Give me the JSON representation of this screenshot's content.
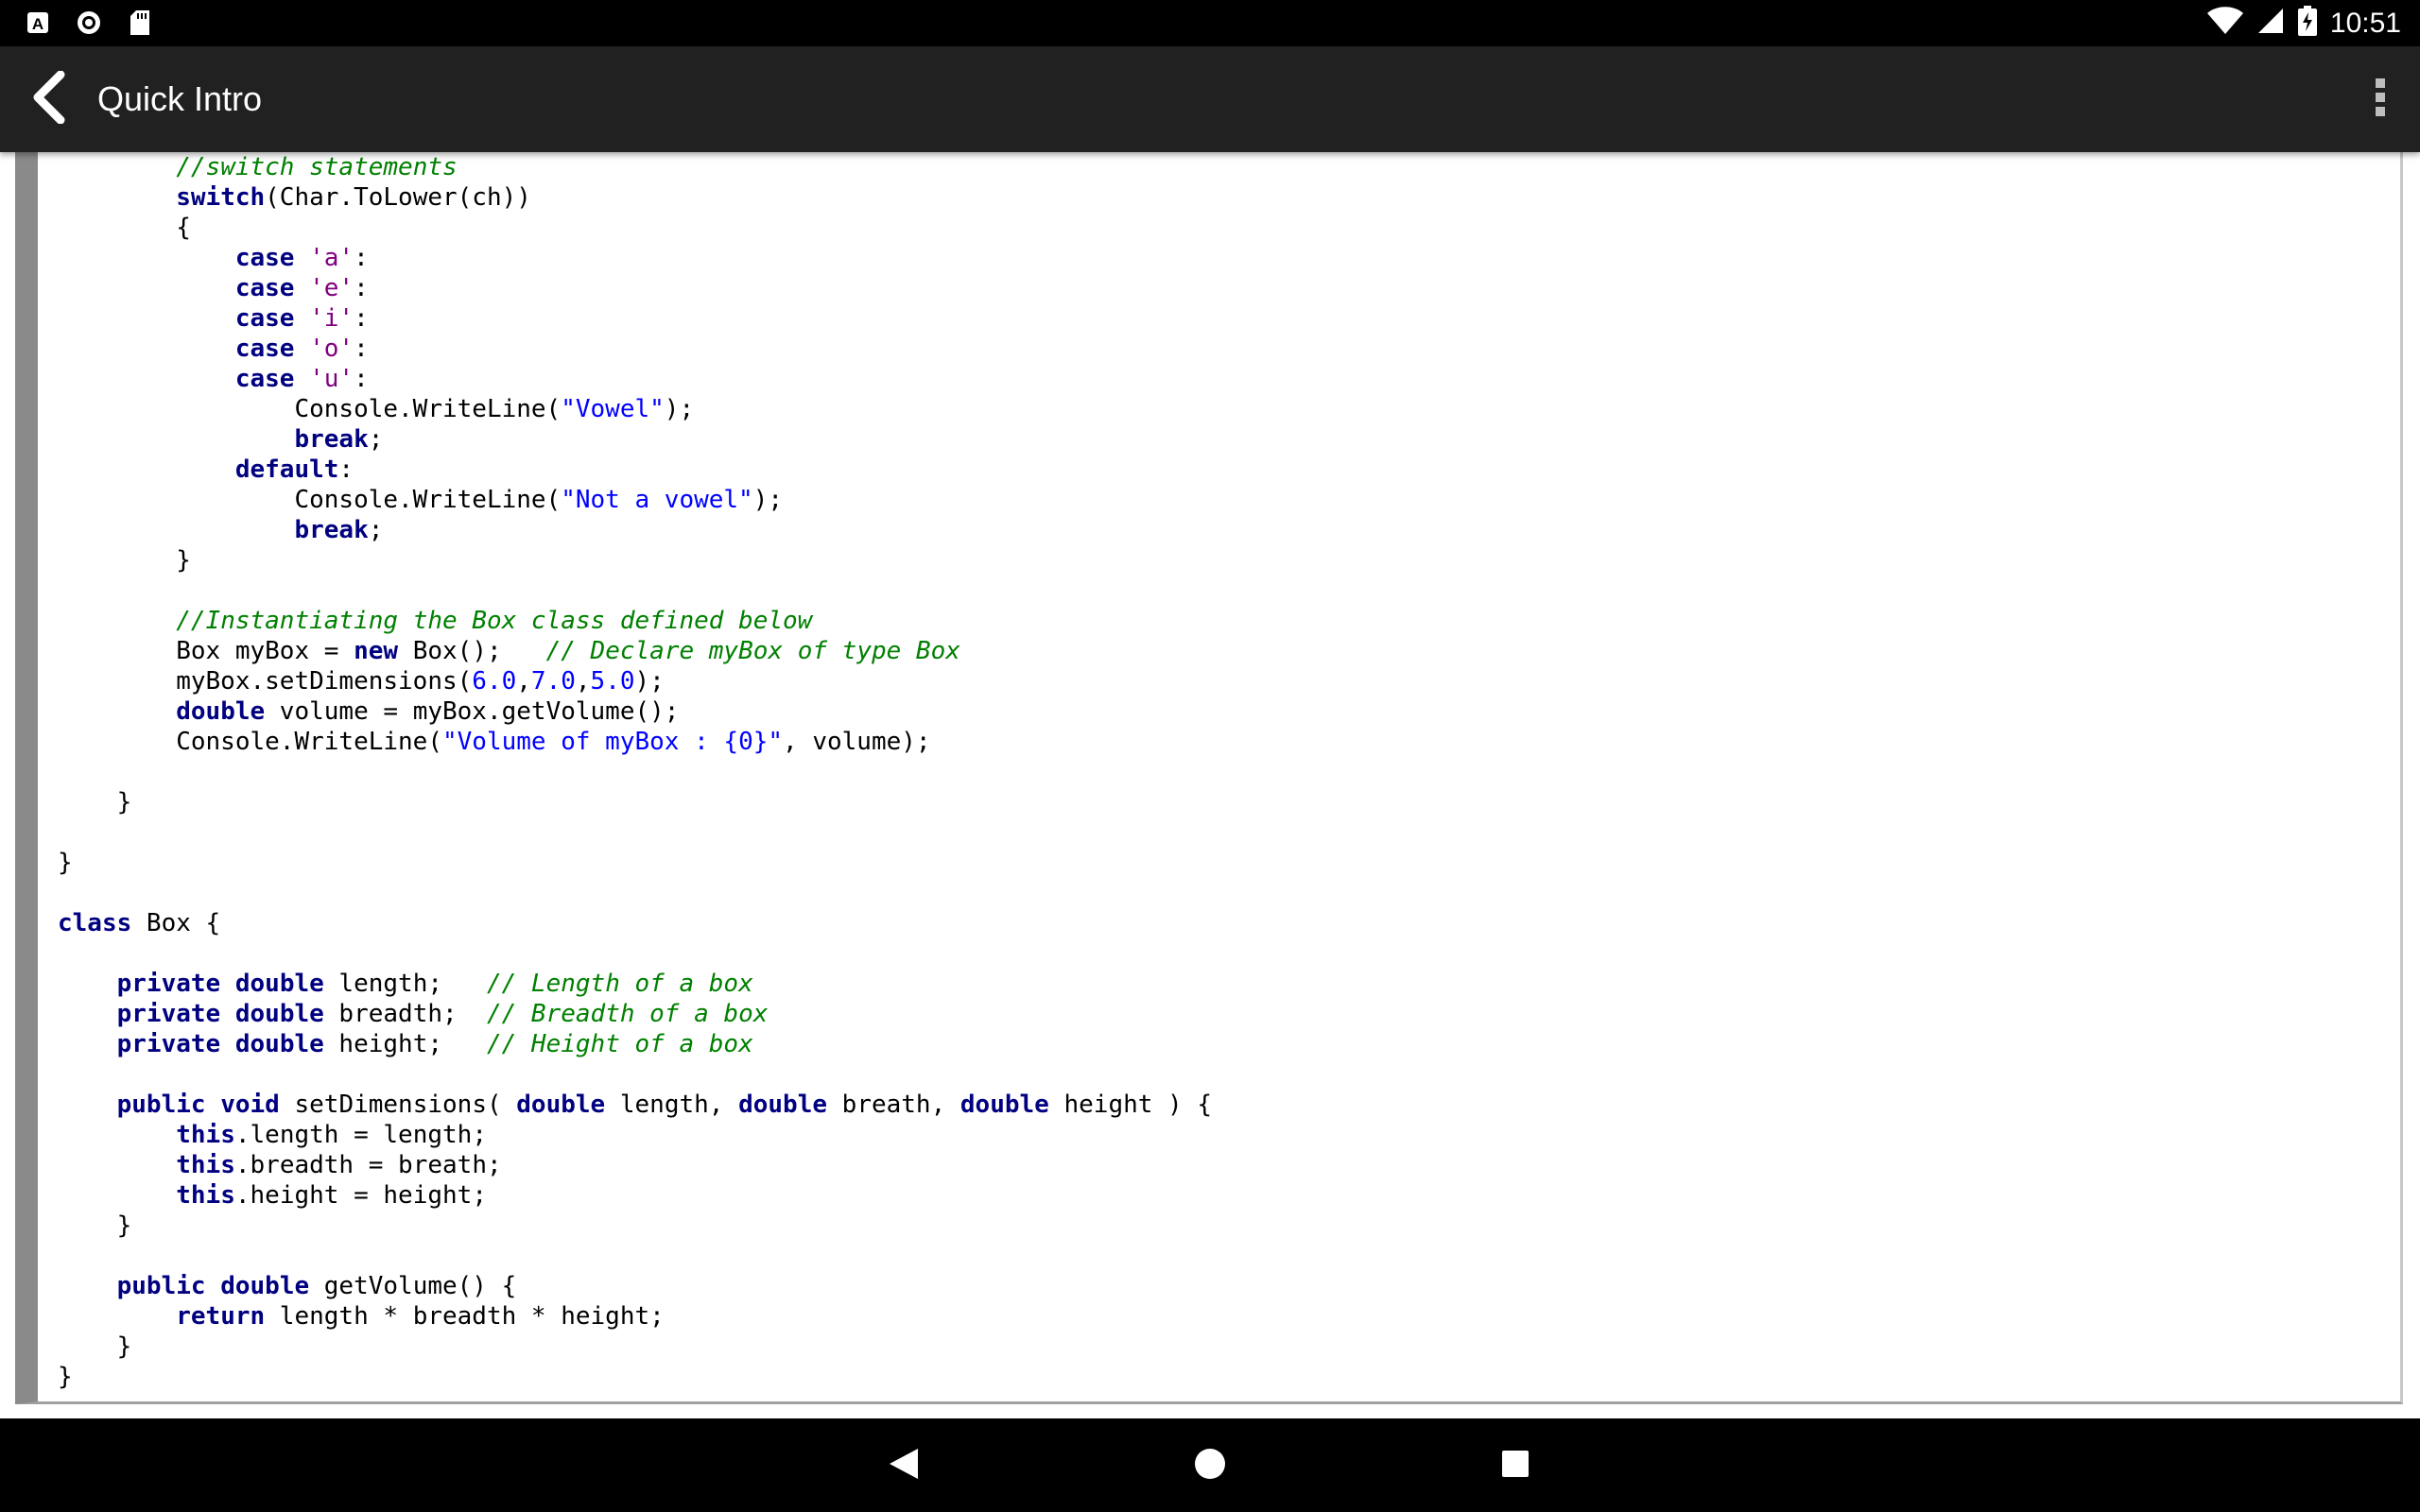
{
  "status_bar": {
    "time": "10:51",
    "left_icons": [
      "a-notification-icon",
      "circle-notification-icon",
      "sd-card-icon"
    ],
    "right_icons": [
      "wifi-icon",
      "cell-signal-icon",
      "battery-charging-icon"
    ]
  },
  "toolbar": {
    "title": "Quick Intro",
    "back_icon": "back-arrow-icon",
    "menu_icon": "overflow-menu-icon"
  },
  "code": {
    "language": "C#",
    "lines": [
      [
        [
          "        ",
          "plain"
        ],
        [
          "//switch statements",
          "comment"
        ]
      ],
      [
        [
          "        ",
          "plain"
        ],
        [
          "switch",
          "keyword"
        ],
        [
          "(Char.ToLower(ch))",
          "plain"
        ]
      ],
      [
        [
          "        {",
          "plain"
        ]
      ],
      [
        [
          "            ",
          "plain"
        ],
        [
          "case",
          "keyword"
        ],
        [
          " ",
          "plain"
        ],
        [
          "'a'",
          "char"
        ],
        [
          ":",
          "plain"
        ]
      ],
      [
        [
          "            ",
          "plain"
        ],
        [
          "case",
          "keyword"
        ],
        [
          " ",
          "plain"
        ],
        [
          "'e'",
          "char"
        ],
        [
          ":",
          "plain"
        ]
      ],
      [
        [
          "            ",
          "plain"
        ],
        [
          "case",
          "keyword"
        ],
        [
          " ",
          "plain"
        ],
        [
          "'i'",
          "char"
        ],
        [
          ":",
          "plain"
        ]
      ],
      [
        [
          "            ",
          "plain"
        ],
        [
          "case",
          "keyword"
        ],
        [
          " ",
          "plain"
        ],
        [
          "'o'",
          "char"
        ],
        [
          ":",
          "plain"
        ]
      ],
      [
        [
          "            ",
          "plain"
        ],
        [
          "case",
          "keyword"
        ],
        [
          " ",
          "plain"
        ],
        [
          "'u'",
          "char"
        ],
        [
          ":",
          "plain"
        ]
      ],
      [
        [
          "                Console.WriteLine(",
          "plain"
        ],
        [
          "\"Vowel\"",
          "string"
        ],
        [
          ");",
          "plain"
        ]
      ],
      [
        [
          "                ",
          "plain"
        ],
        [
          "break",
          "keyword"
        ],
        [
          ";",
          "plain"
        ]
      ],
      [
        [
          "            ",
          "plain"
        ],
        [
          "default",
          "keyword"
        ],
        [
          ":",
          "plain"
        ]
      ],
      [
        [
          "                Console.WriteLine(",
          "plain"
        ],
        [
          "\"Not a vowel\"",
          "string"
        ],
        [
          ");",
          "plain"
        ]
      ],
      [
        [
          "                ",
          "plain"
        ],
        [
          "break",
          "keyword"
        ],
        [
          ";",
          "plain"
        ]
      ],
      [
        [
          "        }",
          "plain"
        ]
      ],
      [
        [
          "",
          "plain"
        ]
      ],
      [
        [
          "        ",
          "plain"
        ],
        [
          "//Instantiating the Box class defined below",
          "comment"
        ]
      ],
      [
        [
          "        Box myBox = ",
          "plain"
        ],
        [
          "new",
          "keyword"
        ],
        [
          " Box();   ",
          "plain"
        ],
        [
          "// Declare myBox of type Box",
          "comment"
        ]
      ],
      [
        [
          "        myBox.setDimensions(",
          "plain"
        ],
        [
          "6.0",
          "number"
        ],
        [
          ",",
          "plain"
        ],
        [
          "7.0",
          "number"
        ],
        [
          ",",
          "plain"
        ],
        [
          "5.0",
          "number"
        ],
        [
          ");",
          "plain"
        ]
      ],
      [
        [
          "        ",
          "plain"
        ],
        [
          "double",
          "keyword"
        ],
        [
          " volume = myBox.getVolume();",
          "plain"
        ]
      ],
      [
        [
          "        Console.WriteLine(",
          "plain"
        ],
        [
          "\"Volume of myBox : {0}\"",
          "string"
        ],
        [
          ", volume);",
          "plain"
        ]
      ],
      [
        [
          "",
          "plain"
        ]
      ],
      [
        [
          "    }",
          "plain"
        ]
      ],
      [
        [
          "",
          "plain"
        ]
      ],
      [
        [
          "}",
          "plain"
        ]
      ],
      [
        [
          "",
          "plain"
        ]
      ],
      [
        [
          "class",
          "keyword"
        ],
        [
          " Box {",
          "plain"
        ]
      ],
      [
        [
          "",
          "plain"
        ]
      ],
      [
        [
          "    ",
          "plain"
        ],
        [
          "private",
          "keyword"
        ],
        [
          " ",
          "plain"
        ],
        [
          "double",
          "keyword"
        ],
        [
          " length;   ",
          "plain"
        ],
        [
          "// Length of a box",
          "comment"
        ]
      ],
      [
        [
          "    ",
          "plain"
        ],
        [
          "private",
          "keyword"
        ],
        [
          " ",
          "plain"
        ],
        [
          "double",
          "keyword"
        ],
        [
          " breadth;  ",
          "plain"
        ],
        [
          "// Breadth of a box",
          "comment"
        ]
      ],
      [
        [
          "    ",
          "plain"
        ],
        [
          "private",
          "keyword"
        ],
        [
          " ",
          "plain"
        ],
        [
          "double",
          "keyword"
        ],
        [
          " height;   ",
          "plain"
        ],
        [
          "// Height of a box",
          "comment"
        ]
      ],
      [
        [
          "",
          "plain"
        ]
      ],
      [
        [
          "    ",
          "plain"
        ],
        [
          "public",
          "keyword"
        ],
        [
          " ",
          "plain"
        ],
        [
          "void",
          "keyword"
        ],
        [
          " setDimensions( ",
          "plain"
        ],
        [
          "double",
          "keyword"
        ],
        [
          " length, ",
          "plain"
        ],
        [
          "double",
          "keyword"
        ],
        [
          " breath, ",
          "plain"
        ],
        [
          "double",
          "keyword"
        ],
        [
          " height ) {",
          "plain"
        ]
      ],
      [
        [
          "        ",
          "plain"
        ],
        [
          "this",
          "keyword"
        ],
        [
          ".length = length;",
          "plain"
        ]
      ],
      [
        [
          "        ",
          "plain"
        ],
        [
          "this",
          "keyword"
        ],
        [
          ".breadth = breath;",
          "plain"
        ]
      ],
      [
        [
          "        ",
          "plain"
        ],
        [
          "this",
          "keyword"
        ],
        [
          ".height = height;",
          "plain"
        ]
      ],
      [
        [
          "    }",
          "plain"
        ]
      ],
      [
        [
          "",
          "plain"
        ]
      ],
      [
        [
          "    ",
          "plain"
        ],
        [
          "public",
          "keyword"
        ],
        [
          " ",
          "plain"
        ],
        [
          "double",
          "keyword"
        ],
        [
          " getVolume() {",
          "plain"
        ]
      ],
      [
        [
          "        ",
          "plain"
        ],
        [
          "return",
          "keyword"
        ],
        [
          " length * breadth * height;",
          "plain"
        ]
      ],
      [
        [
          "    }",
          "plain"
        ]
      ],
      [
        [
          "}",
          "plain"
        ]
      ]
    ]
  },
  "nav_bar": {
    "buttons": [
      "nav-back-icon",
      "nav-home-icon",
      "nav-recents-icon"
    ]
  },
  "colors": {
    "status_bar_bg": "#000000",
    "toolbar_bg": "#212121",
    "keyword": "#000080",
    "comment": "#008000",
    "string": "#0000ff",
    "char": "#800080",
    "frame_border": "#8a8a8a"
  }
}
